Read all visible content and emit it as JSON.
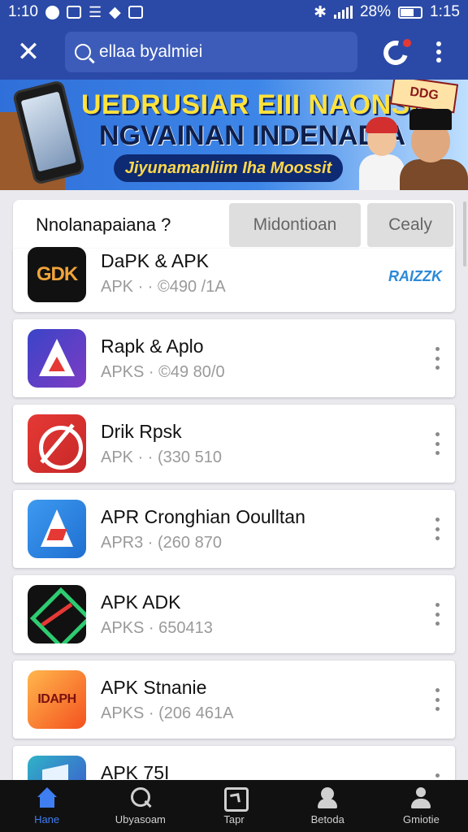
{
  "status_bar": {
    "time_left": "1:10",
    "battery": "28%",
    "time_right": "1:15"
  },
  "app_bar": {
    "search_value": "ellaa byalmiei"
  },
  "banner": {
    "title_line1": "UEDRUSIAR EIII NAONSIA",
    "title_line2": "NGVAINAN INDENADIA",
    "subtitle": "Jiyunamanliim Iha Moossit",
    "tag": "DDG"
  },
  "filter": {
    "title": "Nnolanapaiana ?",
    "buttons": [
      "Midontioan",
      "Cealy"
    ]
  },
  "apps": [
    {
      "name": "DaPK & APK",
      "meta": "APK · · ©490 /1A",
      "icon_text": "GDK",
      "tag": "RAIZZK"
    },
    {
      "name": "Rapk & Aplo",
      "meta": "APKS · ©49 80/0"
    },
    {
      "name": "Drik Rpsk",
      "meta": "APK · · (330 510"
    },
    {
      "name": "APR Cronghian Ooulltan",
      "meta": "APR3 · (260 870"
    },
    {
      "name": "APK ADK",
      "meta": "APKS · 650413"
    },
    {
      "name": "APK Stnanie",
      "meta": "APKS · (206 461A",
      "icon_text": "IDAPH"
    },
    {
      "name": "APK 75I"
    }
  ],
  "bottom_nav": [
    {
      "label": "Hane",
      "icon": "home-icon",
      "active": true
    },
    {
      "label": "Ubyasoam",
      "icon": "search-icon"
    },
    {
      "label": "Tapr",
      "icon": "tab-icon"
    },
    {
      "label": "Betoda",
      "icon": "badge-icon"
    },
    {
      "label": "Gmiotie",
      "icon": "user-icon"
    }
  ],
  "colors": {
    "header": "#2b4aa7",
    "accent": "#3f7ef0",
    "nav_background": "#111111"
  }
}
